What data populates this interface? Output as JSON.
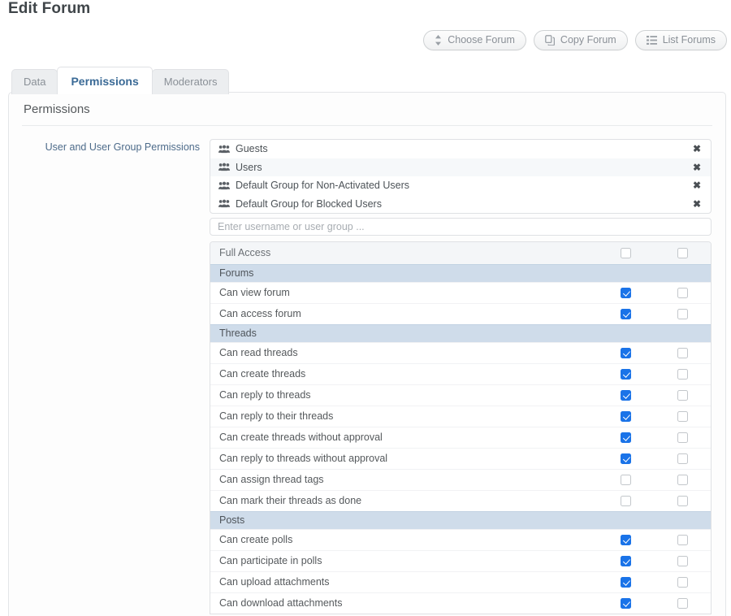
{
  "page_title": "Edit Forum",
  "toolbar": {
    "buttons": [
      {
        "label": "Choose Forum",
        "icon": "sort-updown-icon"
      },
      {
        "label": "Copy Forum",
        "icon": "copy-icon"
      },
      {
        "label": "List Forums",
        "icon": "list-icon"
      }
    ]
  },
  "tabs": [
    {
      "label": "Data",
      "active": false
    },
    {
      "label": "Permissions",
      "active": true
    },
    {
      "label": "Moderators",
      "active": false
    }
  ],
  "panel": {
    "heading": "Permissions",
    "field_label": "User and User Group Permissions",
    "groups": [
      {
        "name": "Guests",
        "icon": "users-group-icon",
        "remove": "✖"
      },
      {
        "name": "Users",
        "icon": "users-group-icon",
        "remove": "✖"
      },
      {
        "name": "Default Group for Non-Activated Users",
        "icon": "users-group-icon",
        "remove": "✖"
      },
      {
        "name": "Default Group for Blocked Users",
        "icon": "users-group-icon",
        "remove": "✖"
      }
    ],
    "group_input": {
      "value": "",
      "placeholder": "Enter username or user group ..."
    },
    "permission_rows": [
      {
        "type": "fullaccess",
        "label": "Full Access",
        "col1": false,
        "col2": false
      },
      {
        "type": "section",
        "label": "Forums"
      },
      {
        "type": "item",
        "label": "Can view forum",
        "col1": true,
        "col2": false
      },
      {
        "type": "item",
        "label": "Can access forum",
        "col1": true,
        "col2": false
      },
      {
        "type": "section",
        "label": "Threads"
      },
      {
        "type": "item",
        "label": "Can read threads",
        "col1": true,
        "col2": false
      },
      {
        "type": "item",
        "label": "Can create threads",
        "col1": true,
        "col2": false
      },
      {
        "type": "item",
        "label": "Can reply to threads",
        "col1": true,
        "col2": false
      },
      {
        "type": "item",
        "label": "Can reply to their threads",
        "col1": true,
        "col2": false
      },
      {
        "type": "item",
        "label": "Can create threads without approval",
        "col1": true,
        "col2": false
      },
      {
        "type": "item",
        "label": "Can reply to threads without approval",
        "col1": true,
        "col2": false
      },
      {
        "type": "item",
        "label": "Can assign thread tags",
        "col1": false,
        "col2": false
      },
      {
        "type": "item",
        "label": "Can mark their threads as done",
        "col1": false,
        "col2": false
      },
      {
        "type": "section",
        "label": "Posts"
      },
      {
        "type": "item",
        "label": "Can create polls",
        "col1": true,
        "col2": false
      },
      {
        "type": "item",
        "label": "Can participate in polls",
        "col1": true,
        "col2": false
      },
      {
        "type": "item",
        "label": "Can upload attachments",
        "col1": true,
        "col2": false
      },
      {
        "type": "item",
        "label": "Can download attachments",
        "col1": true,
        "col2": false
      }
    ]
  },
  "colors": {
    "accent_checkbox": "#1a73e8",
    "section_header_bg": "#cfdcea",
    "tab_active_text": "#3a6a96",
    "field_label_text": "#4d6b8a"
  }
}
